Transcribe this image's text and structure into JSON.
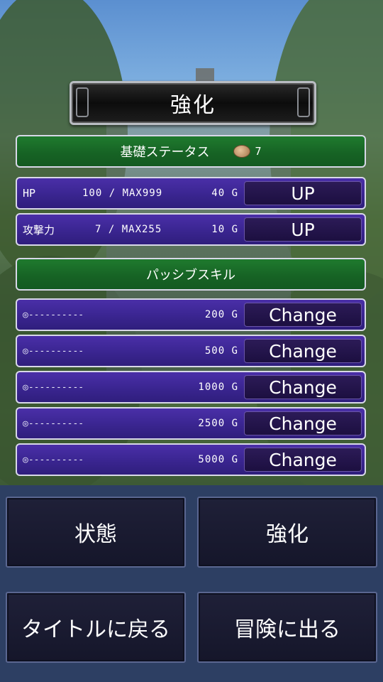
{
  "title": "強化",
  "base_status": {
    "header": "基礎ステータス",
    "currency_icon": "coin-icon",
    "currency_count": "7",
    "stats": [
      {
        "label": "HP",
        "value": "100 / MAX999",
        "cost": "40 G",
        "button": "UP"
      },
      {
        "label": "攻撃力",
        "value": "7 / MAX255",
        "cost": "10 G",
        "button": "UP"
      }
    ]
  },
  "passive_skills": {
    "header": "パッシブスキル",
    "items": [
      {
        "name": "◎----------",
        "cost": "200 G",
        "button": "Change"
      },
      {
        "name": "◎----------",
        "cost": "500 G",
        "button": "Change"
      },
      {
        "name": "◎----------",
        "cost": "1000 G",
        "button": "Change"
      },
      {
        "name": "◎----------",
        "cost": "2500 G",
        "button": "Change"
      },
      {
        "name": "◎----------",
        "cost": "5000 G",
        "button": "Change"
      }
    ]
  },
  "menu": {
    "status": "状態",
    "enhance": "強化",
    "back_to_title": "タイトルに戻る",
    "go_adventure": "冒険に出る"
  },
  "colors": {
    "header_green": "#166224",
    "row_purple": "#3a2590",
    "button_dark_purple": "#1c0f40",
    "menu_bg": "#2d3f63"
  }
}
